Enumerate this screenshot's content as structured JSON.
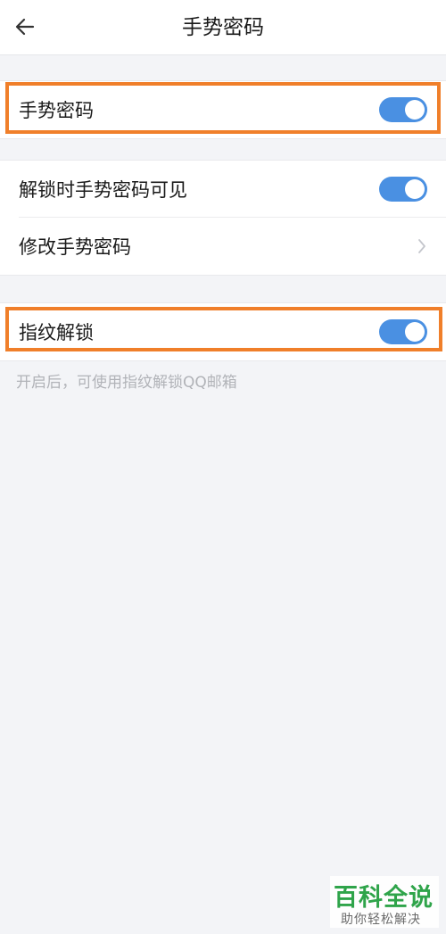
{
  "header": {
    "title": "手势密码",
    "back_icon": "arrow-left-icon"
  },
  "group1": {
    "items": [
      {
        "label": "手势密码",
        "toggle_on": true
      }
    ]
  },
  "group2": {
    "items": [
      {
        "label": "解锁时手势密码可见",
        "toggle_on": true
      },
      {
        "label": "修改手势密码",
        "icon": "chevron-right-icon"
      }
    ]
  },
  "group3": {
    "items": [
      {
        "label": "指纹解锁",
        "toggle_on": true
      }
    ],
    "hint": "开启后，可使用指纹解锁QQ邮箱"
  },
  "watermark": {
    "main": "百科全说",
    "sub": "助你轻松解决"
  },
  "colors": {
    "toggle_on": "#4a90e2",
    "highlight": "#f07f2a",
    "background": "#f3f4f7",
    "watermark_green": "#2fa44a"
  }
}
